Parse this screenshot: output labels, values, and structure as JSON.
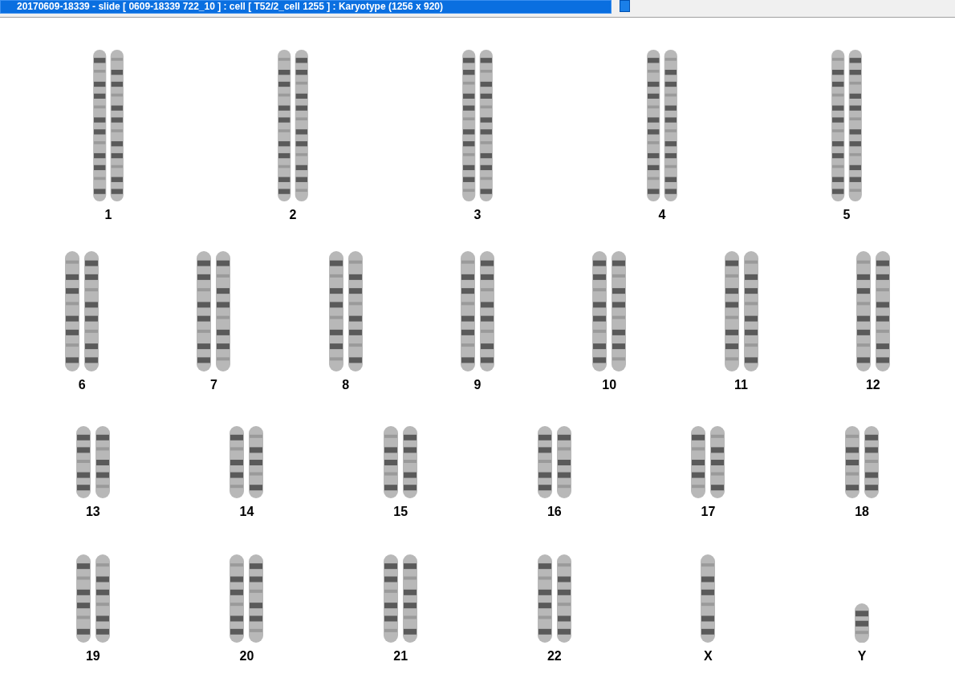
{
  "window": {
    "title": "20170609-18339 - slide [ 0609-18339 722_10 ] : cell [ T52/2_cell 1255 ] : Karyotype  (1256 x 920)"
  },
  "karyotype_rows": [
    {
      "items": [
        {
          "label": "1",
          "kind": "pair"
        },
        {
          "label": "2",
          "kind": "pair"
        },
        {
          "label": "3",
          "kind": "pair"
        },
        {
          "label": "4",
          "kind": "pair"
        },
        {
          "label": "5",
          "kind": "pair"
        }
      ]
    },
    {
      "items": [
        {
          "label": "6",
          "kind": "pair"
        },
        {
          "label": "7",
          "kind": "pair"
        },
        {
          "label": "8",
          "kind": "pair"
        },
        {
          "label": "9",
          "kind": "pair"
        },
        {
          "label": "10",
          "kind": "pair"
        },
        {
          "label": "11",
          "kind": "pair"
        },
        {
          "label": "12",
          "kind": "pair"
        }
      ]
    },
    {
      "items": [
        {
          "label": "13",
          "kind": "pair"
        },
        {
          "label": "14",
          "kind": "pair"
        },
        {
          "label": "15",
          "kind": "pair"
        },
        {
          "label": "16",
          "kind": "pair"
        },
        {
          "label": "17",
          "kind": "pair"
        },
        {
          "label": "18",
          "kind": "pair"
        }
      ]
    },
    {
      "items": [
        {
          "label": "19",
          "kind": "pair"
        },
        {
          "label": "20",
          "kind": "pair"
        },
        {
          "label": "21",
          "kind": "pair"
        },
        {
          "label": "22",
          "kind": "pair"
        },
        {
          "label": "X",
          "kind": "single"
        },
        {
          "label": "Y",
          "kind": "single"
        }
      ]
    }
  ]
}
